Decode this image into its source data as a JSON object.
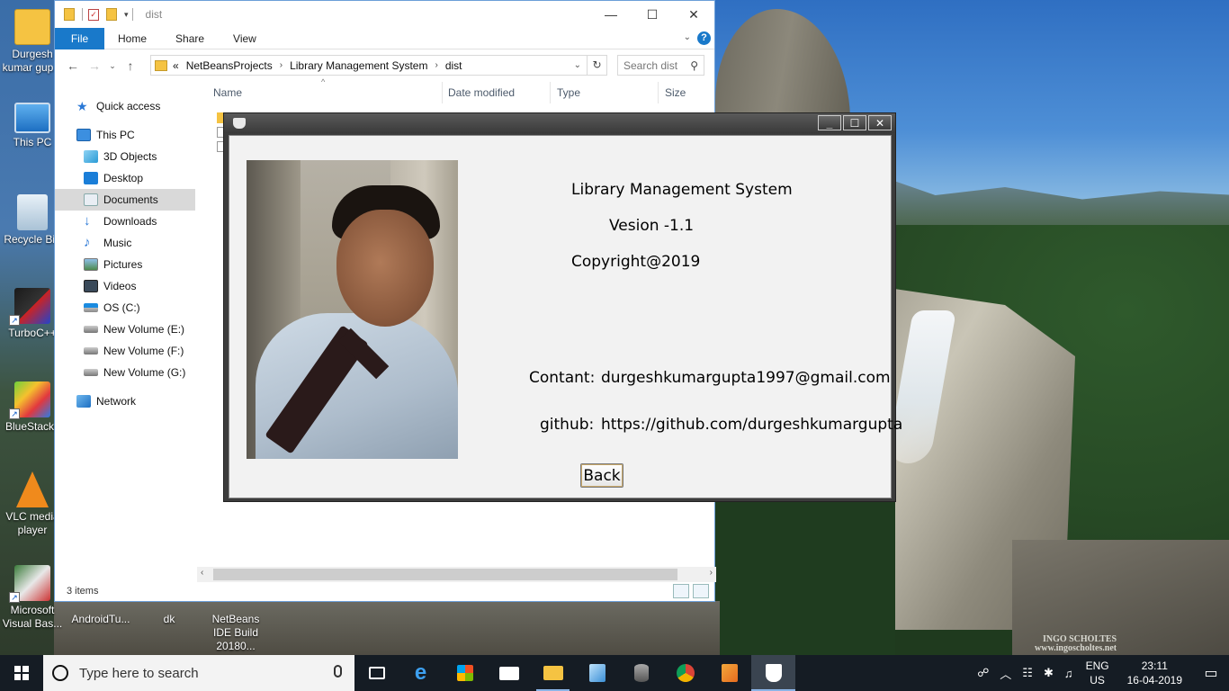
{
  "desktop": {
    "icons": [
      {
        "label": "Durgesh kumar gup..."
      },
      {
        "label": "This PC"
      },
      {
        "label": "Recycle Bin"
      },
      {
        "label": "TurboC++"
      },
      {
        "label": "BlueStacks"
      },
      {
        "label": "VLC media player"
      },
      {
        "label": "Microsoft Visual Bas..."
      },
      {
        "label": "AndroidTu..."
      },
      {
        "label": "dk"
      },
      {
        "label": "NetBeans IDE Build 20180..."
      }
    ],
    "watermark_line1": "INGO SCHOLTES",
    "watermark_line2": "www.ingoscholtes.net"
  },
  "explorer": {
    "title": "dist",
    "ribbon_tabs": [
      "File",
      "Home",
      "Share",
      "View"
    ],
    "breadcrumb": [
      "«",
      "NetBeansProjects",
      "Library Management System",
      "dist"
    ],
    "search_placeholder": "Search dist",
    "columns": [
      "Name",
      "Date modified",
      "Type",
      "Size"
    ],
    "nav": [
      {
        "label": "Quick access",
        "icon": "star-icon"
      },
      {
        "label": "This PC",
        "icon": "computer-icon"
      },
      {
        "label": "3D Objects",
        "icon": "cube-icon"
      },
      {
        "label": "Desktop",
        "icon": "desktop-icon"
      },
      {
        "label": "Documents",
        "icon": "document-icon",
        "selected": true
      },
      {
        "label": "Downloads",
        "icon": "download-icon"
      },
      {
        "label": "Music",
        "icon": "music-icon"
      },
      {
        "label": "Pictures",
        "icon": "picture-icon"
      },
      {
        "label": "Videos",
        "icon": "video-icon"
      },
      {
        "label": "OS (C:)",
        "icon": "drive-icon"
      },
      {
        "label": "New Volume (E:)",
        "icon": "drive-icon"
      },
      {
        "label": "New Volume (F:)",
        "icon": "drive-icon"
      },
      {
        "label": "New Volume (G:)",
        "icon": "drive-icon"
      },
      {
        "label": "Network",
        "icon": "network-icon"
      }
    ],
    "status": "3 items"
  },
  "dialog": {
    "app_name": "Library Management System",
    "version": "Vesion -1.1",
    "copyright": "Copyright@2019",
    "contact_label": "Contant:",
    "contact_value": "durgeshkumargupta1997@gmail.com",
    "github_label": "github:",
    "github_value": "https://github.com/durgeshkumargupta",
    "back_label": "Back"
  },
  "taskbar": {
    "search_placeholder": "Type here to search",
    "language": "ENG",
    "region": "US",
    "time": "23:11",
    "date": "16-04-2019"
  }
}
